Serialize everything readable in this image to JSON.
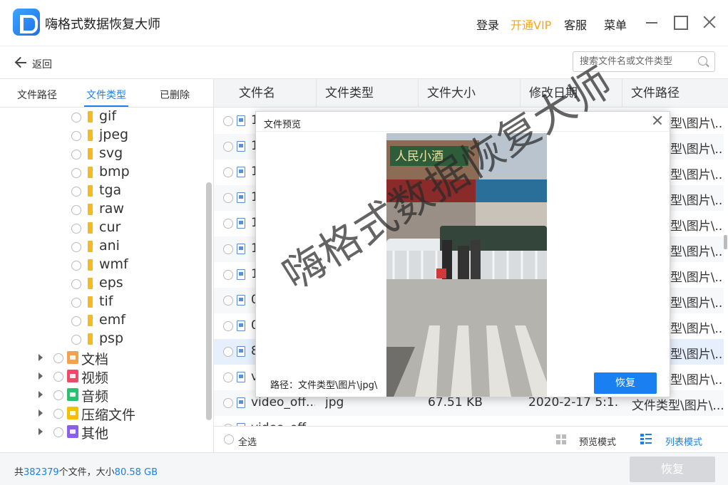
{
  "app": {
    "title": "嗨格式数据恢复大师"
  },
  "topbar": {
    "login": "登录",
    "vip": "开通VIP",
    "service": "客服",
    "menu": "菜单"
  },
  "backbar": {
    "back_label": "返回",
    "search_placeholder": "搜索文件名或文件类型"
  },
  "left_tabs": [
    "文件路径",
    "文件类型",
    "已删除"
  ],
  "tree": {
    "subtypes": [
      "gif",
      "jpeg",
      "svg",
      "bmp",
      "tga",
      "raw",
      "cur",
      "ani",
      "wmf",
      "eps",
      "tif",
      "emf",
      "psp"
    ],
    "categories": [
      {
        "label": "文档",
        "color": "#f5a04a"
      },
      {
        "label": "视频",
        "color": "#f04a6a"
      },
      {
        "label": "音频",
        "color": "#2fbf71"
      },
      {
        "label": "压缩文件",
        "color": "#f5c000"
      },
      {
        "label": "其他",
        "color": "#8a5cf0"
      }
    ]
  },
  "table": {
    "headers": [
      "文件名",
      "文件类型",
      "文件大小",
      "修改日期",
      "文件路径"
    ],
    "rows": [
      {
        "name": "1",
        "path": "型\\图片\\..."
      },
      {
        "name": "1",
        "path": "型\\图片\\..."
      },
      {
        "name": "1",
        "path": "型\\图片\\..."
      },
      {
        "name": "1",
        "path": "型\\图片\\..."
      },
      {
        "name": "1",
        "path": "型\\图片\\..."
      },
      {
        "name": "1",
        "path": "型\\图片\\..."
      },
      {
        "name": "1",
        "path": "型\\图片\\..."
      },
      {
        "name": "0",
        "path": "型\\图片\\..."
      },
      {
        "name": "0",
        "path": "型\\图片\\..."
      },
      {
        "name": "8",
        "path": "型\\图片\\..."
      },
      {
        "name": "v",
        "path": "型\\图片\\..."
      },
      {
        "name": "video_off...",
        "type": "jpg",
        "size": "67.51 KB",
        "date": "2020-2-17 5:1...",
        "path": "文件类型\\图片\\..."
      },
      {
        "name": "video_off..."
      }
    ]
  },
  "table_footer": {
    "select_all": "全选",
    "preview_mode": "预览模式",
    "list_mode": "列表模式"
  },
  "status": {
    "prefix": "共",
    "count": "382379",
    "mid": "个文件，大小",
    "size": "80.58 GB",
    "recover": "恢复"
  },
  "preview": {
    "title": "文件预览",
    "path_label": "路径：文件类型\\图片\\jpg\\",
    "recover": "恢复",
    "sign_text": "人民小酒"
  },
  "watermark": "嗨格式数据恢复大师"
}
